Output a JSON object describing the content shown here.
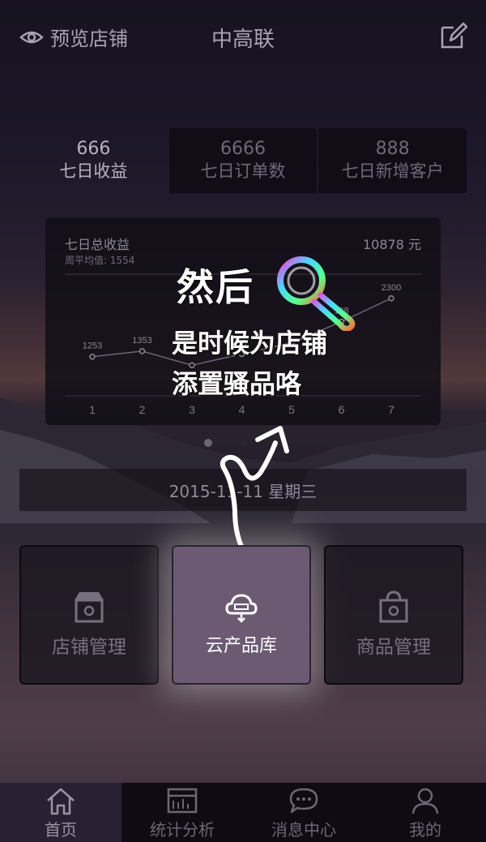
{
  "header": {
    "preview_label": "预览店铺",
    "title": "中高联"
  },
  "tabs": [
    {
      "value": "666",
      "label": "七日收益"
    },
    {
      "value": "6666",
      "label": "七日订单数"
    },
    {
      "value": "888",
      "label": "七日新增客户"
    }
  ],
  "chart_card": {
    "title": "七日总收益",
    "subtitle": "周平均值: 1554",
    "total": "10878 元"
  },
  "chart_data": {
    "type": "line",
    "title": "七日总收益",
    "categories": [
      "1",
      "2",
      "3",
      "4",
      "5",
      "6",
      "7"
    ],
    "series": [
      {
        "values": [
          1253,
          1353,
          1100,
          1300,
          1500,
          1880,
          2300
        ]
      }
    ],
    "data_labels": [
      "1253",
      "1353",
      "",
      "13",
      "",
      "188",
      "2300"
    ],
    "grid": true
  },
  "overlay": {
    "line1": "然后",
    "line2": "是时候为店铺",
    "line3": "添置骚品咯"
  },
  "date_bar": {
    "text": "2015-11-11  星期三"
  },
  "tiles": [
    {
      "label": "店铺管理",
      "icon": "shop-icon"
    },
    {
      "label": "云产品库",
      "icon": "cloud-icon"
    },
    {
      "label": "商品管理",
      "icon": "bag-icon"
    }
  ],
  "bottom_nav": [
    {
      "label": "首页",
      "icon": "home-icon"
    },
    {
      "label": "统计分析",
      "icon": "calendar-chart-icon"
    },
    {
      "label": "消息中心",
      "icon": "chat-icon"
    },
    {
      "label": "我的",
      "icon": "user-icon"
    }
  ],
  "colors": {
    "highlight_tile": "#6c5a73",
    "nav_active": "#2a2034"
  }
}
